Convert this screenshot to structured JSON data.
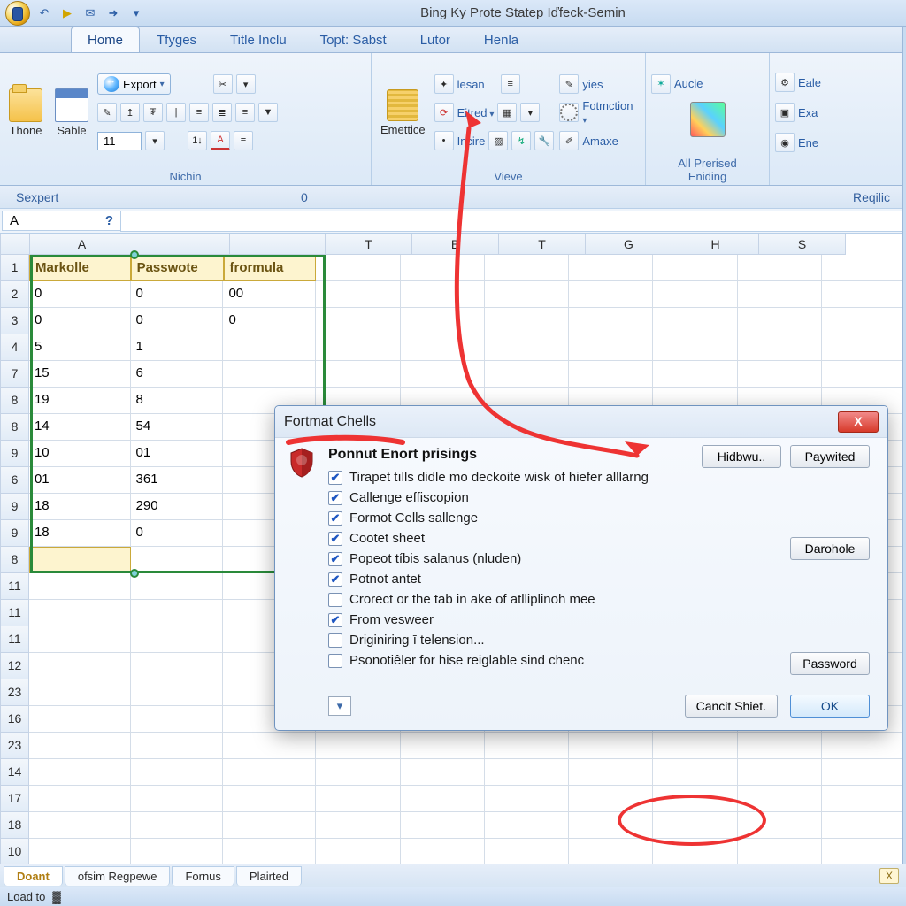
{
  "title": "Bing Ky Prote Statep Iďfeck-Semin",
  "tabs": [
    "Home",
    "Tfyges",
    "Title Inclu",
    "Topt: Sabst",
    "Lutor",
    "Henla"
  ],
  "activeTab": 0,
  "ribbon": {
    "group1": {
      "btn1": "Thone",
      "btn2": "Sable",
      "label": "Nichin",
      "export": "Export",
      "fontSize": "11"
    },
    "group2": {
      "btn": "Emettice",
      "label": "Vieve",
      "opt1": "lesan",
      "opt2": "Eitred",
      "opt3": "Incire",
      "opt4": "yies",
      "opt5": "Fotmction",
      "opt6": "Amaxe"
    },
    "group3": {
      "btn1": "All Prerised",
      "btn2": "Eniding",
      "s1": "Aucie"
    },
    "group4": {
      "s1": "Eale",
      "s2": "Exa",
      "s3": "Ene"
    }
  },
  "subbar": {
    "left": "Sexpert",
    "center": "0",
    "right": "Reqilic"
  },
  "nameBox": "A",
  "columns": [
    "A",
    "T",
    "B",
    "T",
    "G",
    "H",
    "S"
  ],
  "headers": [
    "Markolle",
    "Passwote",
    "frormula"
  ],
  "rows": [
    {
      "n": "1"
    },
    {
      "n": "2",
      "c": [
        "0",
        "0",
        "00"
      ]
    },
    {
      "n": "3",
      "c": [
        "0",
        "0",
        "0"
      ]
    },
    {
      "n": "4",
      "c": [
        "5",
        "1",
        ""
      ]
    },
    {
      "n": "7",
      "c": [
        "15",
        "6",
        ""
      ]
    },
    {
      "n": "8",
      "c": [
        "19",
        "8",
        ""
      ]
    },
    {
      "n": "8",
      "c": [
        "14",
        "54",
        ""
      ]
    },
    {
      "n": "9",
      "c": [
        "10",
        "01",
        ""
      ]
    },
    {
      "n": "6",
      "c": [
        "01",
        "361",
        ""
      ]
    },
    {
      "n": "9",
      "c": [
        "18",
        "290",
        ""
      ]
    },
    {
      "n": "9",
      "c": [
        "18",
        "0",
        ""
      ]
    },
    {
      "n": "8",
      "c": [
        "",
        "",
        ""
      ]
    },
    {
      "n": "11"
    },
    {
      "n": "11"
    },
    {
      "n": "11"
    },
    {
      "n": "12"
    },
    {
      "n": "23"
    },
    {
      "n": "16"
    },
    {
      "n": "23"
    },
    {
      "n": "14"
    },
    {
      "n": "17"
    },
    {
      "n": "18"
    },
    {
      "n": "10"
    }
  ],
  "dialog": {
    "title": "Fortmat Chells",
    "subtitle": "Ponnut Enort prisings",
    "btnHide": "Hidbwu..",
    "btnPay": "Paywited",
    "btnDar": "Darohole",
    "btnPass": "Password",
    "checks": [
      {
        "t": "Tirapet tılls didle mo deckoite wisk of hiefer alllarng",
        "c": true
      },
      {
        "t": "Callenge effiscopion",
        "c": true
      },
      {
        "t": "Formot Cells sallenge",
        "c": true
      },
      {
        "t": "Cootet sheet",
        "c": true
      },
      {
        "t": "Popeot tíbis salanus (nluden)",
        "c": true
      },
      {
        "t": "Potnot antet",
        "c": true
      },
      {
        "t": "Crorect or the tab in ake of atlliplinoh mee",
        "c": false
      },
      {
        "t": "From vesweer",
        "c": true
      },
      {
        "t": "Driginiring ī telension...",
        "c": false
      },
      {
        "t": "Psonotiêler for hise reiglable sind chenc",
        "c": false
      }
    ],
    "cancel": "Cancit Shiet.",
    "ok": "OK"
  },
  "sheetTabs": [
    "Doant",
    "ofsim Regpewe",
    "Fornus",
    "Plairted"
  ],
  "sheetX": "X",
  "status": "Load to"
}
